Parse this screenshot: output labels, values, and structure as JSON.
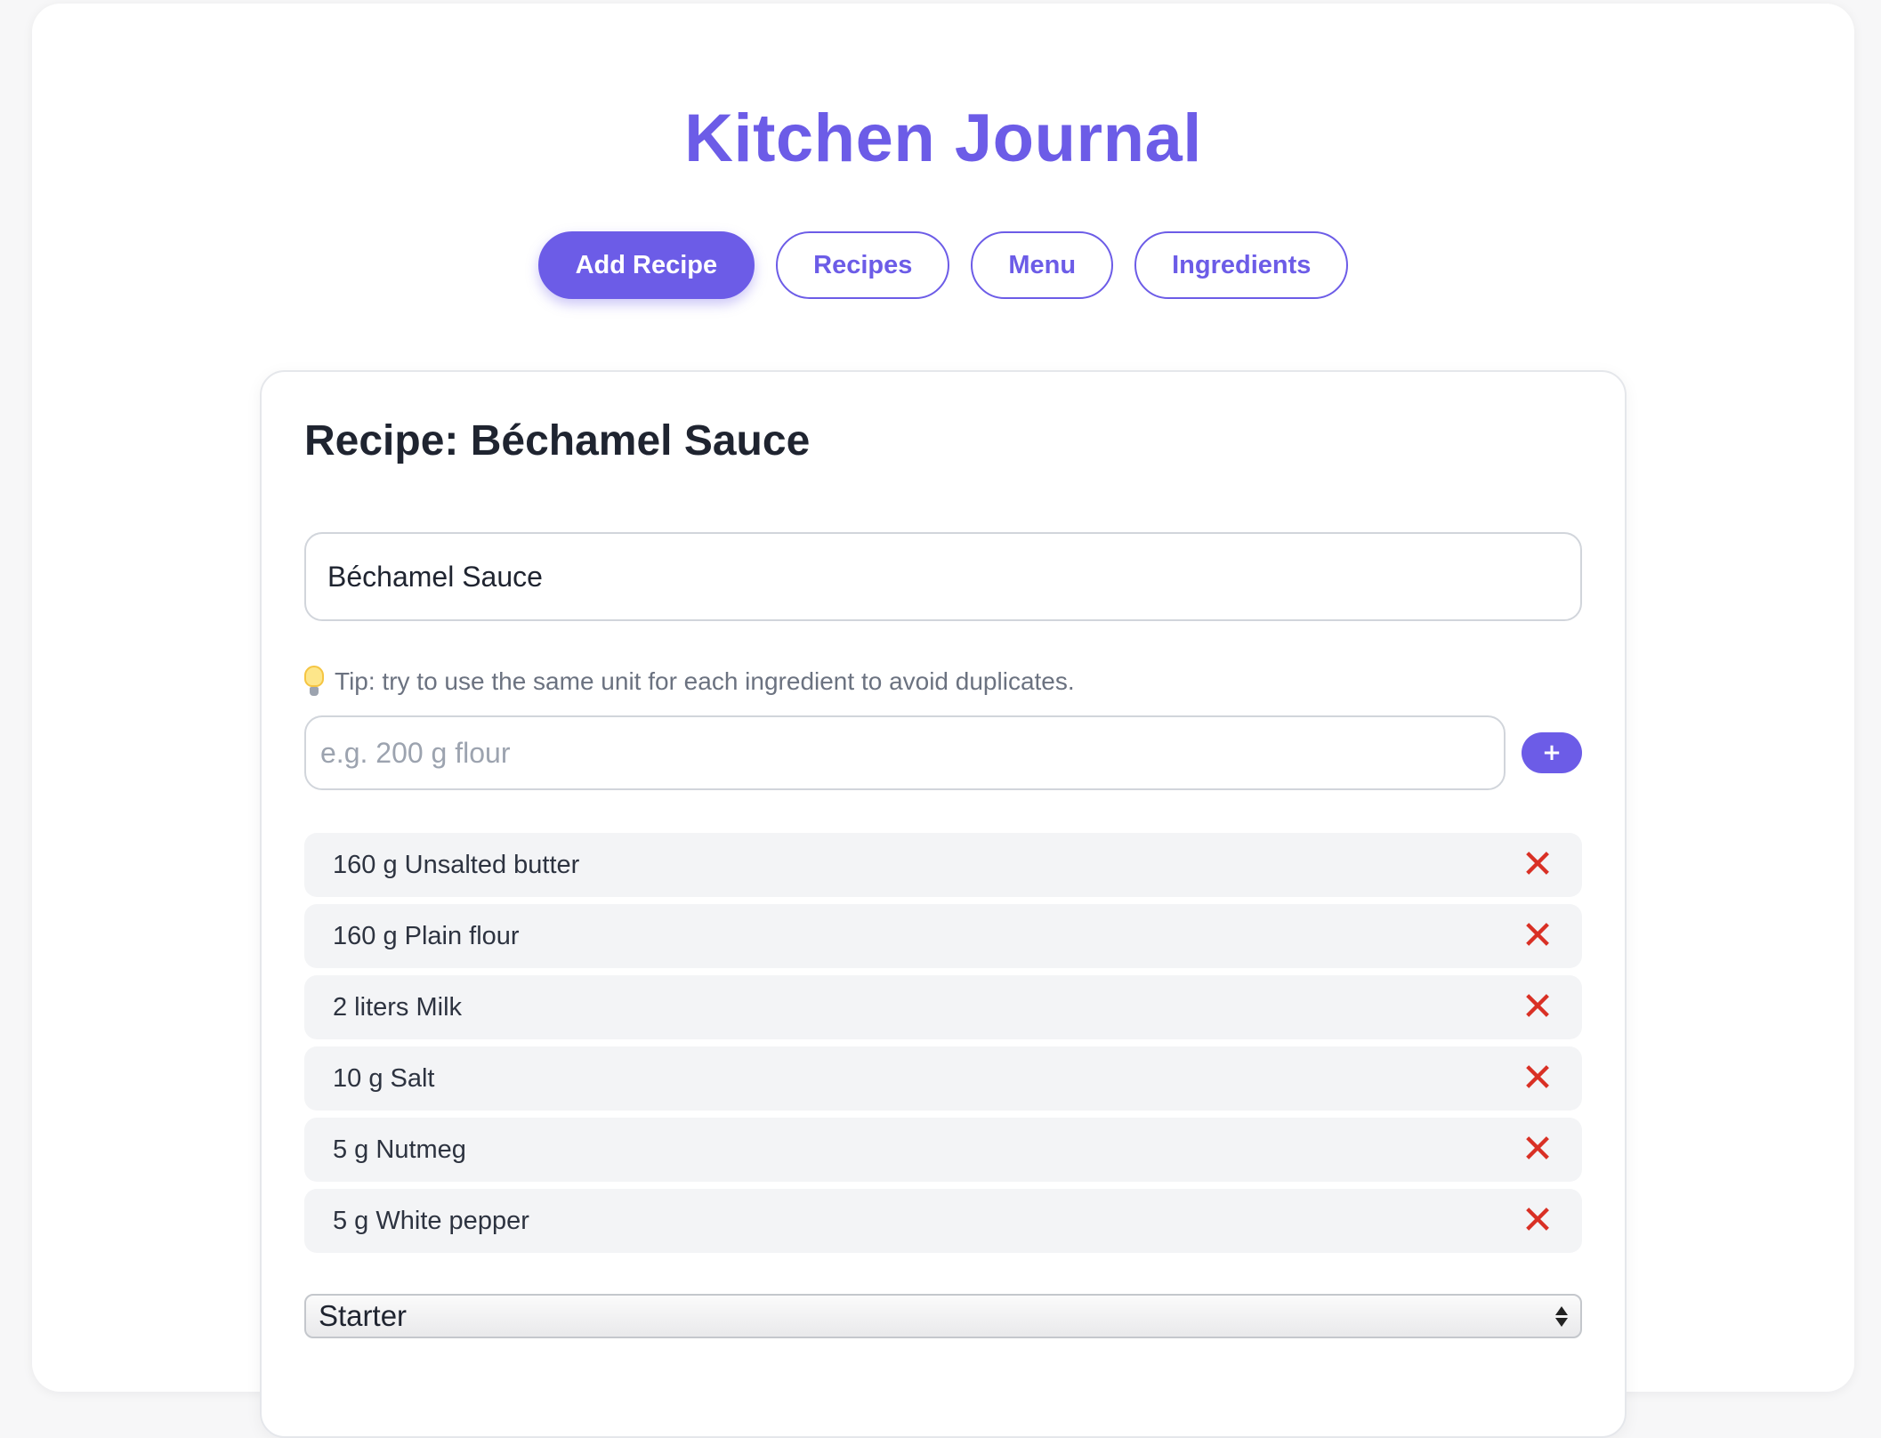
{
  "app": {
    "title": "Kitchen Journal"
  },
  "nav": {
    "tabs": [
      {
        "label": "Add Recipe",
        "active": true
      },
      {
        "label": "Recipes",
        "active": false
      },
      {
        "label": "Menu",
        "active": false
      },
      {
        "label": "Ingredients",
        "active": false
      }
    ]
  },
  "recipe": {
    "heading": "Recipe: Béchamel Sauce",
    "name_value": "Béchamel Sauce",
    "tip_icon": "lightbulb-icon",
    "tip_text": "Tip: try to use the same unit for each ingredient to avoid duplicates.",
    "ingredient_placeholder": "e.g. 200 g flour",
    "add_button_label": "+",
    "ingredients": [
      {
        "text": "160 g Unsalted butter",
        "remove_icon": "✕"
      },
      {
        "text": "160 g Plain flour",
        "remove_icon": "✕"
      },
      {
        "text": "2 liters Milk",
        "remove_icon": "✕"
      },
      {
        "text": "10 g Salt",
        "remove_icon": "✕"
      },
      {
        "text": "5 g Nutmeg",
        "remove_icon": "✕"
      },
      {
        "text": "5 g White pepper",
        "remove_icon": "✕"
      }
    ],
    "category_selected": "Starter"
  },
  "colors": {
    "accent": "#6c5ce7",
    "remove": "#d93025",
    "row_background": "#f3f4f6"
  }
}
